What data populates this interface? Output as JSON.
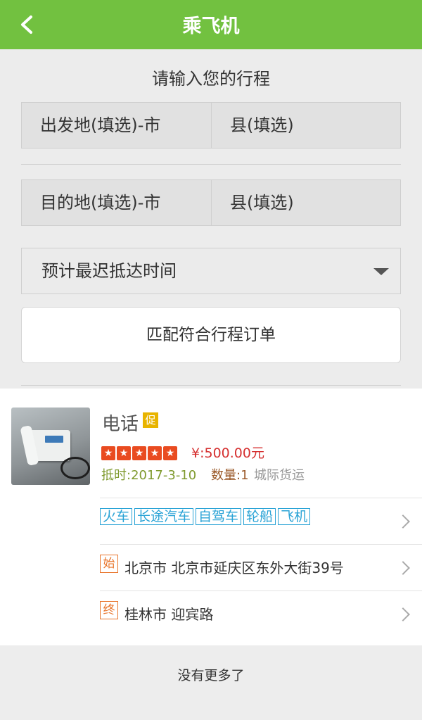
{
  "header": {
    "title": "乘飞机"
  },
  "form": {
    "heading": "请输入您的行程",
    "departure_city": "出发地(填选)-市",
    "departure_county": "县(填选)",
    "destination_city": "目的地(填选)-市",
    "destination_county": "县(填选)",
    "arrival_time": "预计最迟抵达时间",
    "match_button": "匹配符合行程订单"
  },
  "order": {
    "name": "电话",
    "promo_badge": "促",
    "rating": 5,
    "price": "¥:500.00元",
    "date": "抵时:2017-3-10",
    "quantity": "数量:1",
    "service": "城际货运",
    "transport_modes": [
      "火车",
      "长途汽车",
      "自驾车",
      "轮船",
      "飞机"
    ],
    "origin_icon": "始",
    "origin": "北京市 北京市延庆区东外大街39号",
    "dest_icon": "终",
    "destination": "桂林市 迎宾路"
  },
  "footer": {
    "no_more": "没有更多了"
  },
  "colors": {
    "header": "#72c140",
    "price": "#d52f2f",
    "star": "#e94b20",
    "tag": "#2aa3d6",
    "address_icon": "#e8742a"
  }
}
